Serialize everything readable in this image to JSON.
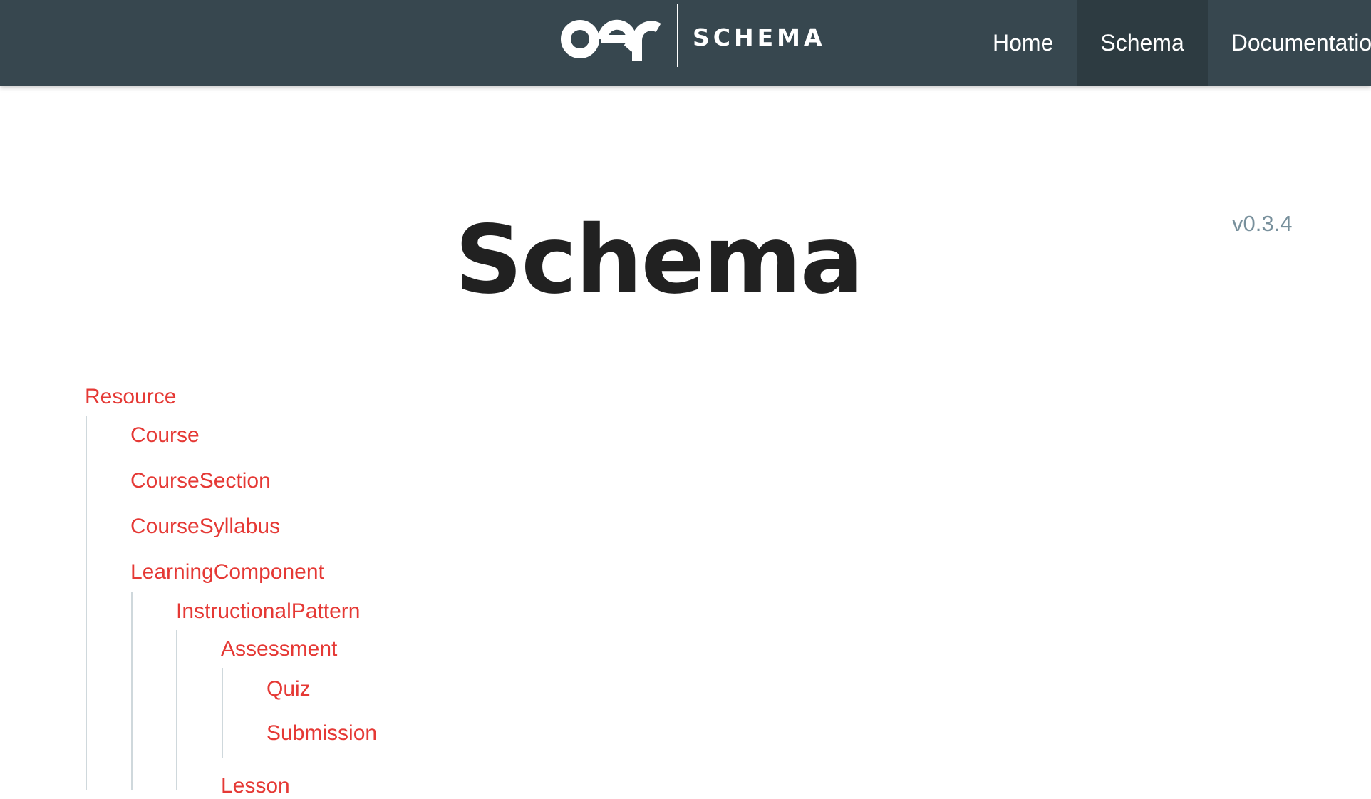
{
  "navbar": {
    "brand_text": "SCHEMA",
    "links": [
      {
        "label": "Home",
        "active": false
      },
      {
        "label": "Schema",
        "active": true
      },
      {
        "label": "Documentation",
        "active": false
      }
    ]
  },
  "page": {
    "title": "Schema",
    "version": "v0.3.4"
  },
  "tree": {
    "items": [
      {
        "label": "Resource",
        "depth": 0
      },
      {
        "label": "Course",
        "depth": 1
      },
      {
        "label": "CourseSection",
        "depth": 1
      },
      {
        "label": "CourseSyllabus",
        "depth": 1
      },
      {
        "label": "LearningComponent",
        "depth": 1
      },
      {
        "label": "InstructionalPattern",
        "depth": 2
      },
      {
        "label": "Assessment",
        "depth": 3
      },
      {
        "label": "Quiz",
        "depth": 4
      },
      {
        "label": "Submission",
        "depth": 4
      },
      {
        "label": "Lesson",
        "depth": 3
      }
    ]
  },
  "colors": {
    "navbar_bg": "#37474f",
    "navbar_active_bg": "#2d3b41",
    "link_red": "#e53935",
    "version_gray": "#78909c",
    "title_dark": "#212121"
  }
}
